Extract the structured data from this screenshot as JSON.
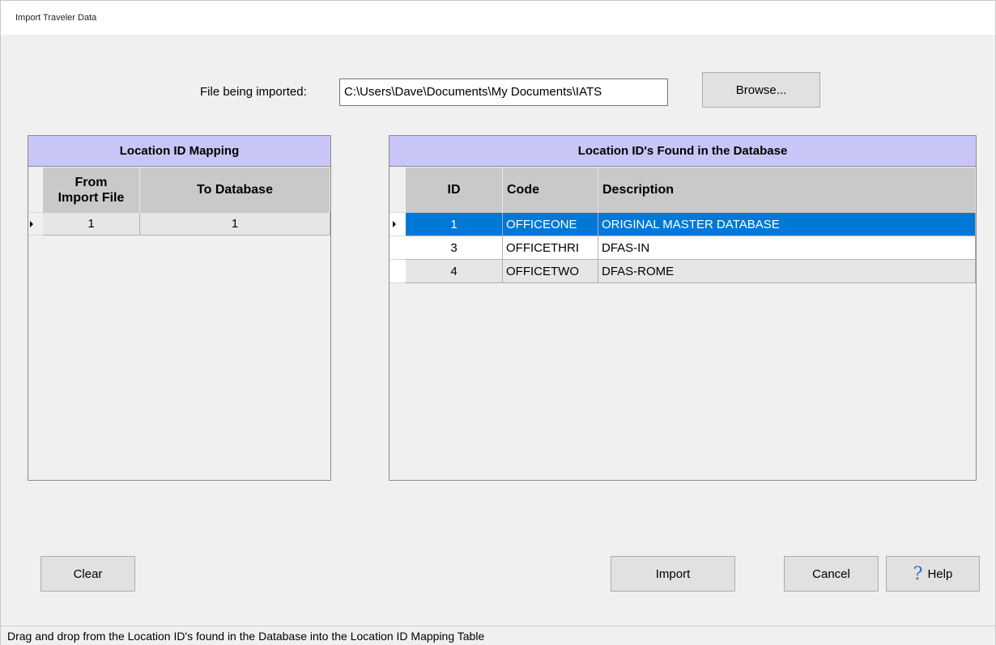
{
  "window": {
    "title": "Import Traveler Data"
  },
  "file": {
    "label": "File being imported:",
    "value": "C:\\Users\\Dave\\Documents\\My Documents\\IATS",
    "browse_label": "Browse..."
  },
  "mapping": {
    "title": "Location ID Mapping",
    "col_from": "From\nImport File",
    "col_from_line1": "From",
    "col_from_line2": "Import File",
    "col_to": "To Database",
    "rows": [
      {
        "from": "1",
        "to": "1"
      }
    ]
  },
  "database": {
    "title": "Location ID's Found in the Database",
    "columns": {
      "id": "ID",
      "code": "Code",
      "description": "Description"
    },
    "rows": [
      {
        "id": "1",
        "code": "OFFICEONE",
        "description": "ORIGINAL MASTER DATABASE"
      },
      {
        "id": "3",
        "code": "OFFICETHRI",
        "description": "DFAS-IN"
      },
      {
        "id": "4",
        "code": "OFFICETWO",
        "description": "DFAS-ROME"
      }
    ]
  },
  "buttons": {
    "clear": "Clear",
    "import": "Import",
    "cancel": "Cancel",
    "help": "Help"
  },
  "status": {
    "text": "Drag and drop from the Location ID's found in the Database into the Location ID Mapping Table"
  },
  "colors": {
    "header_band": "#c8c6f6",
    "selected_row": "#0078d7",
    "column_header": "#c9c9c9"
  }
}
